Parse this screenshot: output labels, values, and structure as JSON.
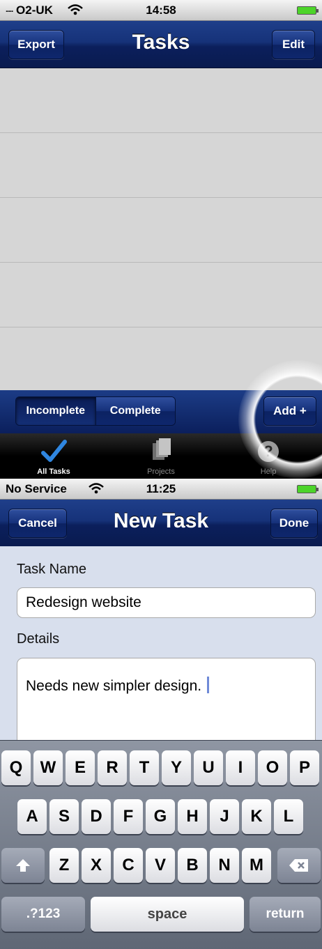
{
  "screen1": {
    "status": {
      "carrier": "O2-UK",
      "time": "14:58"
    },
    "nav": {
      "title": "Tasks",
      "left_button": "Export",
      "right_button": "Edit"
    },
    "tasks": [],
    "filter": {
      "segments": [
        "Incomplete",
        "Complete"
      ],
      "selected": "Incomplete",
      "add_button": "Add +"
    },
    "tabs": [
      {
        "label": "All Tasks",
        "icon": "checkmark-icon",
        "active": true
      },
      {
        "label": "Projects",
        "icon": "documents-icon",
        "active": false
      },
      {
        "label": "Help",
        "icon": "help-icon",
        "active": false
      }
    ]
  },
  "screen2": {
    "status": {
      "carrier": "No Service",
      "time": "11:25"
    },
    "nav": {
      "title": "New Task",
      "left_button": "Cancel",
      "right_button": "Done"
    },
    "form": {
      "task_name_label": "Task Name",
      "task_name_value": "Redesign website",
      "details_label": "Details",
      "details_value": "Needs new simpler design."
    },
    "keyboard": {
      "row1": [
        "Q",
        "W",
        "E",
        "R",
        "T",
        "Y",
        "U",
        "I",
        "O",
        "P"
      ],
      "row2": [
        "A",
        "S",
        "D",
        "F",
        "G",
        "H",
        "J",
        "K",
        "L"
      ],
      "row3": [
        "Z",
        "X",
        "C",
        "V",
        "B",
        "N",
        "M"
      ],
      "numbers_key": ".?123",
      "space_key": "space",
      "return_key": "return"
    }
  },
  "colors": {
    "nav_blue": "#163279",
    "list_gray": "#d6d6d6",
    "form_bg": "#d8dfed",
    "battery_green": "#4cd42a",
    "tab_active": "#2f86e0"
  }
}
